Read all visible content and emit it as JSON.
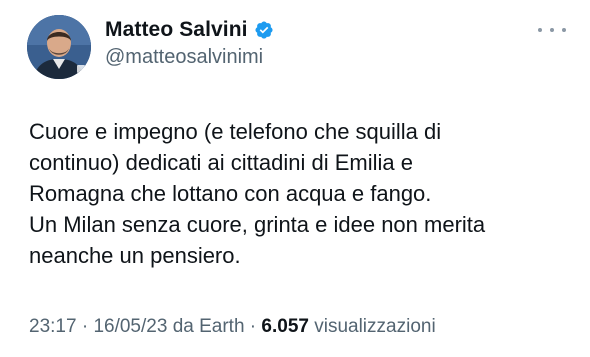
{
  "tweet": {
    "author": {
      "display_name": "Matteo Salvini",
      "handle": "@matteosalvinimi",
      "verified": true,
      "avatar_icon": "profile-photo",
      "verified_icon": "verified-badge-icon"
    },
    "text_lines": [
      "Cuore e impegno (e telefono che squilla di",
      "continuo) dedicati ai cittadini di Emilia e",
      "Romagna che lottano con acqua e fango.",
      "Un Milan senza cuore, grinta e idee non merita",
      "neanche un pensiero."
    ],
    "meta": {
      "time": "23:17",
      "separator": "·",
      "date": "16/05/23",
      "source": "da Earth",
      "views_count": "6.057",
      "views_label": "visualizzazioni"
    },
    "more_icon": "more-options-icon"
  },
  "colors": {
    "text_primary": "#0f1419",
    "text_secondary": "#536471",
    "verified_blue": "#1d9bf0",
    "background": "#ffffff"
  }
}
